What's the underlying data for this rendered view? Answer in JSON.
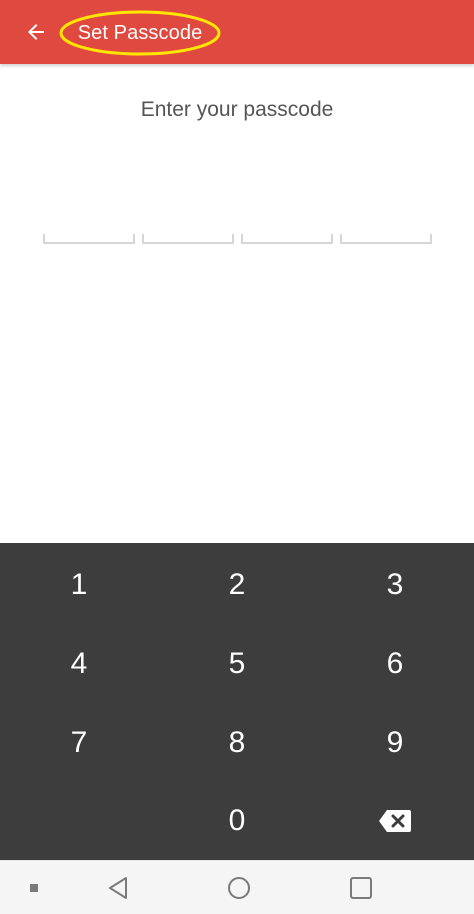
{
  "appbar": {
    "title": "Set Passcode",
    "background": "#e0493f",
    "highlight_color": "#ffe600",
    "back_icon": "arrow-left-icon"
  },
  "passcode": {
    "prompt": "Enter your passcode",
    "slot_count": 4,
    "entered_digits": 0
  },
  "keypad": {
    "background": "#3d3d3d",
    "keys": [
      "1",
      "2",
      "3",
      "4",
      "5",
      "6",
      "7",
      "8",
      "9",
      "0"
    ],
    "delete_icon": "backspace-icon"
  },
  "navbar": {
    "icons": [
      "menu-dot-icon",
      "back-triangle-icon",
      "home-circle-icon",
      "recents-square-icon"
    ]
  }
}
